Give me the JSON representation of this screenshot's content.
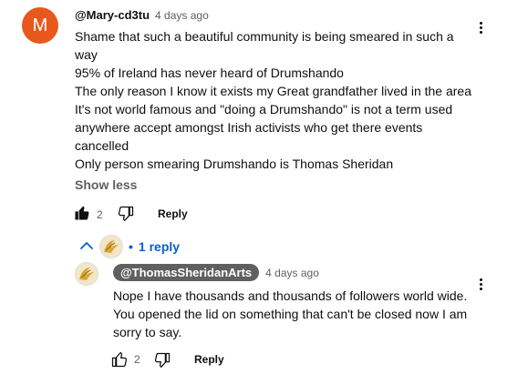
{
  "comment": {
    "avatar_letter": "M",
    "avatar_color": "#e8581d",
    "author": "@Mary-cd3tu",
    "time": "4 days ago",
    "lines": [
      "Shame that such a beautiful community is being smeared in such a",
      "way",
      "95% of Ireland has never heard of Drumshando",
      "The only reason I know it exists my Great grandfather lived in the area",
      "It's not world famous and \"doing a Drumshando\" is not a term used",
      "anywhere accept amongst Irish activists who get there events",
      "cancelled",
      "Only person smearing Drumshando is Thomas Sheridan"
    ],
    "show_less": "Show less",
    "like_count": "2",
    "reply_label": "Reply"
  },
  "replies_toggle": {
    "label": "1 reply",
    "bullet": "•"
  },
  "reply": {
    "author": "@ThomasSheridanArts",
    "time": "4 days ago",
    "lines": [
      "Nope I have thousands and thousands of followers world wide.",
      "You opened the lid on something that can't be closed now I am",
      "sorry to say."
    ],
    "like_count": "2",
    "reply_label": "Reply"
  },
  "colors": {
    "link_blue": "#065fd4",
    "secondary_text": "#606060",
    "badge_bg": "#606060"
  }
}
